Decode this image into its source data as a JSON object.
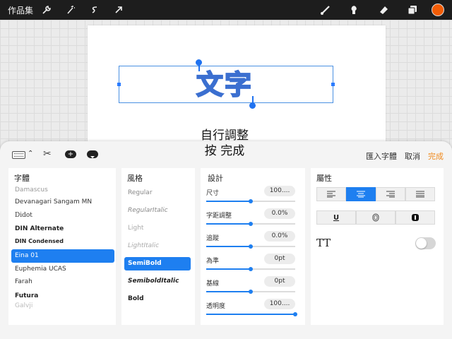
{
  "toolbar": {
    "gallery_label": "作品集",
    "left_icons": [
      "wrench-icon",
      "magic-wand-icon",
      "selection-icon",
      "transform-arrow-icon"
    ],
    "right_icons": [
      "brush-icon",
      "smudge-icon",
      "eraser-icon",
      "layers-icon"
    ],
    "color_swatch": "#f25c05"
  },
  "canvas": {
    "text": "文字",
    "text_color": "#f07a2a",
    "outline_color": "#3b6fd0",
    "hint_line1": "自行調整",
    "hint_line2": "按 完成"
  },
  "panel": {
    "import_label": "匯入字體",
    "cancel_label": "取消",
    "done_label": "完成",
    "accent": "#1e7ff0",
    "fonts": {
      "title": "字體",
      "items": [
        "Damascus",
        "Devanagari Sangam MN",
        "Didot",
        "DIN Alternate",
        "DIN Condensed",
        "Eina 01",
        "Euphemia UCAS",
        "Farah",
        "Futura",
        "Galvji"
      ],
      "selected": "Eina 01"
    },
    "styles": {
      "title": "風格",
      "items": [
        "Regular",
        "RegularItalic",
        "Light",
        "LightItalic",
        "SemiBold",
        "SemiboldItalic",
        "Bold"
      ],
      "selected": "SemiBold"
    },
    "design": {
      "title": "設計",
      "rows": [
        {
          "label": "尺寸",
          "value": "100....",
          "level": 0.5
        },
        {
          "label": "字距調整",
          "value": "0.0%",
          "level": 0.5
        },
        {
          "label": "追蹤",
          "value": "0.0%",
          "level": 0.5
        },
        {
          "label": "為準",
          "value": "0pt",
          "level": 0.5
        },
        {
          "label": "基線",
          "value": "0pt",
          "level": 0.5
        },
        {
          "label": "透明度",
          "value": "100....",
          "level": 1.0
        }
      ]
    },
    "attributes": {
      "title": "屬性",
      "alignment_selected": "center",
      "tt_label": "TT",
      "allcaps_toggle_on": false
    }
  }
}
